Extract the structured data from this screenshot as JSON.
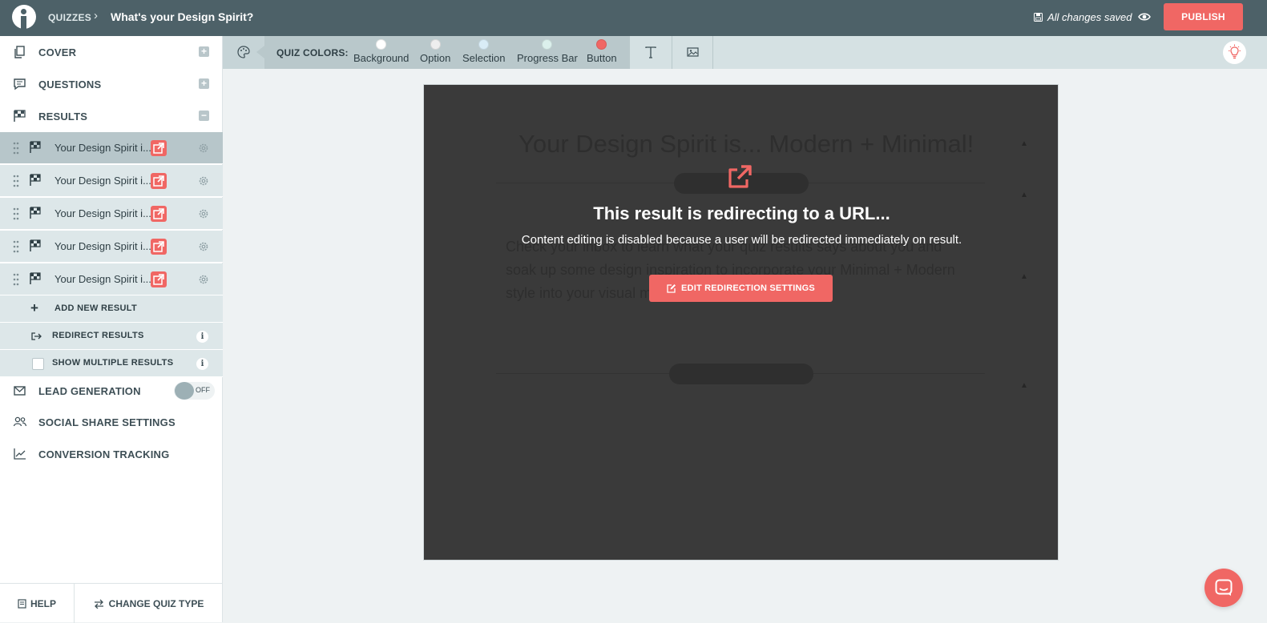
{
  "topbar": {
    "breadcrumb_root": "QUIZZES",
    "breadcrumb_separator": "›",
    "quiz_title": "What's your Design Spirit?",
    "save_status": "All changes saved",
    "publish_label": "PUBLISH"
  },
  "sidebar": {
    "cover_label": "COVER",
    "questions_label": "QUESTIONS",
    "results_label": "RESULTS",
    "results": [
      {
        "label": "Your Design Spirit i..."
      },
      {
        "label": "Your Design Spirit i..."
      },
      {
        "label": "Your Design Spirit i..."
      },
      {
        "label": "Your Design Spirit i..."
      },
      {
        "label": "Your Design Spirit i..."
      }
    ],
    "add_result_label": "ADD NEW RESULT",
    "redirect_label": "REDIRECT RESULTS",
    "multiple_label": "SHOW MULTIPLE RESULTS",
    "lead_generation_label": "LEAD GENERATION",
    "lead_toggle_state": "OFF",
    "social_label": "SOCIAL SHARE SETTINGS",
    "conversion_label": "CONVERSION TRACKING",
    "help_label": "HELP",
    "change_type_label": "CHANGE QUIZ TYPE"
  },
  "toolbar": {
    "quiz_colors_label": "QUIZ COLORS:",
    "swatches": [
      {
        "label": "Background",
        "color": "#ffffff"
      },
      {
        "label": "Option",
        "color": "#eeeeee"
      },
      {
        "label": "Selection",
        "color": "#d9ecf6"
      },
      {
        "label": "Progress Bar",
        "color": "#dbf0ec"
      },
      {
        "label": "Button",
        "color": "#f06764"
      }
    ]
  },
  "canvas": {
    "ghost_title": "Your Design Spirit is... Modern + Minimal!",
    "ghost_body": "Check your inbox to learn what your quiz results says about you and soak up some design inspiration to incorporate your Minimal + Modern style into your visual marketing.",
    "overlay_title": "This result is redirecting to a URL...",
    "overlay_description": "Content editing is disabled because a user will be redirected immediately on result.",
    "edit_button_label": "EDIT REDIRECTION SETTINGS"
  },
  "colors": {
    "topbar_bg": "#4d6168",
    "accent": "#f06764",
    "sidebar_active": "#b7c6ca"
  }
}
